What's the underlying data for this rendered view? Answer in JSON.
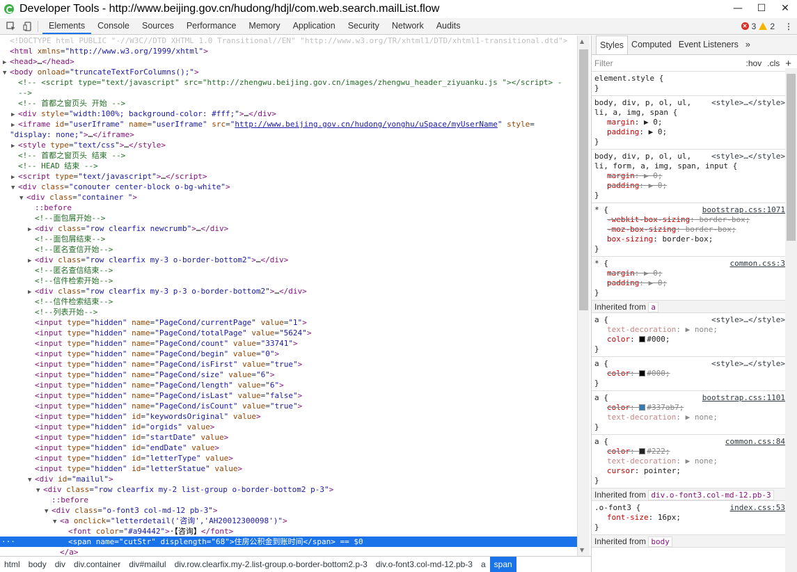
{
  "window": {
    "title": "Developer Tools - http://www.beijing.gov.cn/hudong/hdjl/com.web.search.mailList.flow",
    "minimize": "—",
    "maximize": "☐",
    "close": "✕"
  },
  "toolbar": {
    "tabs": [
      "Elements",
      "Console",
      "Sources",
      "Performance",
      "Memory",
      "Application",
      "Security",
      "Network",
      "Audits"
    ],
    "errors": "3",
    "warnings": "2"
  },
  "elements": {
    "lines": [
      {
        "i": 0,
        "t": "",
        "h": "<span class=\"dt\">&lt;!DOCTYPE html PUBLIC \"-//W3C//DTD XHTML 1.0 Transitional//EN\" \"http://www.w3.org/TR/xhtml1/DTD/xhtml1-transitional.dtd\"&gt;</span>"
      },
      {
        "i": 0,
        "t": "",
        "h": "<span class=\"tg\">&lt;html</span> <span class=\"an\">xmlns</span>=<span class=\"av\">\"http://www.w3.org/1999/xhtml\"</span><span class=\"tg\">&gt;</span>"
      },
      {
        "i": 0,
        "t": "▶",
        "h": "<span class=\"tg\">&lt;head&gt;</span><span class=\"tx\">…</span><span class=\"tg\">&lt;/head&gt;</span>"
      },
      {
        "i": 0,
        "t": "▼",
        "h": "<span class=\"tg\">&lt;body</span> <span class=\"an\">onload</span>=<span class=\"av\">\"truncateTextForColumns();\"</span><span class=\"tg\">&gt;</span>"
      },
      {
        "i": 1,
        "t": "",
        "h": "<span class=\"cm\">&lt;!-- &lt;script type=\"text/javascript\" src=\"http://zhengwu.beijing.gov.cn/images/zhengwu_header_ziyuanku.js \"&gt;&lt;/script&gt;  -</span>"
      },
      {
        "i": 1,
        "t": "",
        "h": "<span class=\"cm\">--&gt;</span>"
      },
      {
        "i": 1,
        "t": "",
        "h": "<span class=\"cm\">&lt;!-- 首都之窗页头 开始 --&gt;</span>"
      },
      {
        "i": 1,
        "t": "▶",
        "h": "<span class=\"tg\">&lt;div</span> <span class=\"an\">style</span>=<span class=\"av\">\"width:100%; background-color: #fff;\"</span><span class=\"tg\">&gt;</span><span class=\"tx\">…</span><span class=\"tg\">&lt;/div&gt;</span>"
      },
      {
        "i": 1,
        "t": "▶",
        "h": "<span class=\"tg\">&lt;iframe</span> <span class=\"an\">id</span>=<span class=\"av\">\"userIframe\"</span> <span class=\"an\">name</span>=<span class=\"av\">\"userIframe\"</span> <span class=\"an\">src</span>=<span class=\"av\">\"</span><span class=\"lk\">http://www.beijing.gov.cn/hudong/yonghu/uSpace/myUserName</span><span class=\"av\">\"</span> <span class=\"an\">style</span>=</span>"
      },
      {
        "i": 0,
        "t": "",
        "h": "<span class=\"av\">\"display: none;\"</span><span class=\"tg\">&gt;</span><span class=\"tx\">…</span><span class=\"tg\">&lt;/iframe&gt;</span>"
      },
      {
        "i": 1,
        "t": "▶",
        "h": "<span class=\"tg\">&lt;style</span> <span class=\"an\">type</span>=<span class=\"av\">\"text/css\"</span><span class=\"tg\">&gt;</span><span class=\"tx\">…</span><span class=\"tg\">&lt;/style&gt;</span>"
      },
      {
        "i": 1,
        "t": "",
        "h": "<span class=\"cm\">&lt;!-- 首都之窗页头 结束 --&gt;</span>"
      },
      {
        "i": 1,
        "t": "",
        "h": "<span class=\"cm\">&lt;!-- HEAD 结束 --&gt;</span>"
      },
      {
        "i": 1,
        "t": "▶",
        "h": "<span class=\"tg\">&lt;script</span> <span class=\"an\">type</span>=<span class=\"av\">\"text/javascript\"</span><span class=\"tg\">&gt;</span><span class=\"tx\">…</span><span class=\"tg\">&lt;/script&gt;</span>"
      },
      {
        "i": 1,
        "t": "▼",
        "h": "<span class=\"tg\">&lt;div</span> <span class=\"an\">class</span>=<span class=\"av\">\"conouter center-block o-bg-white\"</span><span class=\"tg\">&gt;</span>"
      },
      {
        "i": 2,
        "t": "▼",
        "h": "<span class=\"tg\">&lt;div</span> <span class=\"an\">class</span>=<span class=\"av\">\"container \"</span><span class=\"tg\">&gt;</span>"
      },
      {
        "i": 3,
        "t": "",
        "h": "<span class=\"ps\">::before</span>"
      },
      {
        "i": 3,
        "t": "",
        "h": "<span class=\"cm\">&lt;!--面包屑开始--&gt;</span>"
      },
      {
        "i": 3,
        "t": "▶",
        "h": "<span class=\"tg\">&lt;div</span> <span class=\"an\">class</span>=<span class=\"av\">\"row clearfix  newcrumb\"</span><span class=\"tg\">&gt;</span><span class=\"tx\">…</span><span class=\"tg\">&lt;/div&gt;</span>"
      },
      {
        "i": 3,
        "t": "",
        "h": "<span class=\"cm\">&lt;!--面包屑结束--&gt;</span>"
      },
      {
        "i": 3,
        "t": "",
        "h": "<span class=\"cm\">&lt;!--匿名查信开始--&gt;</span>"
      },
      {
        "i": 3,
        "t": "▶",
        "h": "<span class=\"tg\">&lt;div</span> <span class=\"an\">class</span>=<span class=\"av\">\"row clearfix my-3 o-border-bottom2\"</span><span class=\"tg\">&gt;</span><span class=\"tx\">…</span><span class=\"tg\">&lt;/div&gt;</span>"
      },
      {
        "i": 3,
        "t": "",
        "h": "<span class=\"cm\">&lt;!--匿名查信结束--&gt;</span>"
      },
      {
        "i": 3,
        "t": "",
        "h": "<span class=\"cm\">&lt;!--信件检索开始--&gt;</span>"
      },
      {
        "i": 3,
        "t": "▶",
        "h": "<span class=\"tg\">&lt;div</span> <span class=\"an\">class</span>=<span class=\"av\">\"row clearfix my-3 p-3 o-border-bottom2\"</span><span class=\"tg\">&gt;</span><span class=\"tx\">…</span><span class=\"tg\">&lt;/div&gt;</span>"
      },
      {
        "i": 3,
        "t": "",
        "h": "<span class=\"cm\">&lt;!--信件检索结束--&gt;</span>"
      },
      {
        "i": 3,
        "t": "",
        "h": "<span class=\"cm\">&lt;!--列表开始--&gt;</span>"
      },
      {
        "i": 3,
        "t": "",
        "h": "<span class=\"tg\">&lt;input</span> <span class=\"an\">type</span>=<span class=\"av\">\"hidden\"</span> <span class=\"an\">name</span>=<span class=\"av\">\"PageCond/currentPage\"</span> <span class=\"an\">value</span>=<span class=\"av\">\"1\"</span><span class=\"tg\">&gt;</span>"
      },
      {
        "i": 3,
        "t": "",
        "h": "<span class=\"tg\">&lt;input</span> <span class=\"an\">type</span>=<span class=\"av\">\"hidden\"</span> <span class=\"an\">name</span>=<span class=\"av\">\"PageCond/totalPage\"</span> <span class=\"an\">value</span>=<span class=\"av\">\"5624\"</span><span class=\"tg\">&gt;</span>"
      },
      {
        "i": 3,
        "t": "",
        "h": "<span class=\"tg\">&lt;input</span> <span class=\"an\">type</span>=<span class=\"av\">\"hidden\"</span> <span class=\"an\">name</span>=<span class=\"av\">\"PageCond/count\"</span> <span class=\"an\">value</span>=<span class=\"av\">\"33741\"</span><span class=\"tg\">&gt;</span>"
      },
      {
        "i": 3,
        "t": "",
        "h": "<span class=\"tg\">&lt;input</span> <span class=\"an\">type</span>=<span class=\"av\">\"hidden\"</span> <span class=\"an\">name</span>=<span class=\"av\">\"PageCond/begin\"</span> <span class=\"an\">value</span>=<span class=\"av\">\"0\"</span><span class=\"tg\">&gt;</span>"
      },
      {
        "i": 3,
        "t": "",
        "h": "<span class=\"tg\">&lt;input</span> <span class=\"an\">type</span>=<span class=\"av\">\"hidden\"</span> <span class=\"an\">name</span>=<span class=\"av\">\"PageCond/isFirst\"</span> <span class=\"an\">value</span>=<span class=\"av\">\"true\"</span><span class=\"tg\">&gt;</span>"
      },
      {
        "i": 3,
        "t": "",
        "h": "<span class=\"tg\">&lt;input</span> <span class=\"an\">type</span>=<span class=\"av\">\"hidden\"</span> <span class=\"an\">name</span>=<span class=\"av\">\"PageCond/size\"</span> <span class=\"an\">value</span>=<span class=\"av\">\"6\"</span><span class=\"tg\">&gt;</span>"
      },
      {
        "i": 3,
        "t": "",
        "h": "<span class=\"tg\">&lt;input</span> <span class=\"an\">type</span>=<span class=\"av\">\"hidden\"</span> <span class=\"an\">name</span>=<span class=\"av\">\"PageCond/length\"</span> <span class=\"an\">value</span>=<span class=\"av\">\"6\"</span><span class=\"tg\">&gt;</span>"
      },
      {
        "i": 3,
        "t": "",
        "h": "<span class=\"tg\">&lt;input</span> <span class=\"an\">type</span>=<span class=\"av\">\"hidden\"</span> <span class=\"an\">name</span>=<span class=\"av\">\"PageCond/isLast\"</span> <span class=\"an\">value</span>=<span class=\"av\">\"false\"</span><span class=\"tg\">&gt;</span>"
      },
      {
        "i": 3,
        "t": "",
        "h": "<span class=\"tg\">&lt;input</span> <span class=\"an\">type</span>=<span class=\"av\">\"hidden\"</span> <span class=\"an\">name</span>=<span class=\"av\">\"PageCond/isCount\"</span> <span class=\"an\">value</span>=<span class=\"av\">\"true\"</span><span class=\"tg\">&gt;</span>"
      },
      {
        "i": 3,
        "t": "",
        "h": "<span class=\"tg\">&lt;input</span> <span class=\"an\">type</span>=<span class=\"av\">\"hidden\"</span> <span class=\"an\">id</span>=<span class=\"av\">\"keywordsOriginal\"</span> <span class=\"an\">value</span><span class=\"tg\">&gt;</span>"
      },
      {
        "i": 3,
        "t": "",
        "h": "<span class=\"tg\">&lt;input</span> <span class=\"an\">type</span>=<span class=\"av\">\"hidden\"</span> <span class=\"an\">id</span>=<span class=\"av\">\"orgids\"</span> <span class=\"an\">value</span><span class=\"tg\">&gt;</span>"
      },
      {
        "i": 3,
        "t": "",
        "h": "<span class=\"tg\">&lt;input</span> <span class=\"an\">type</span>=<span class=\"av\">\"hidden\"</span> <span class=\"an\">id</span>=<span class=\"av\">\"startDate\"</span> <span class=\"an\">value</span><span class=\"tg\">&gt;</span>"
      },
      {
        "i": 3,
        "t": "",
        "h": "<span class=\"tg\">&lt;input</span> <span class=\"an\">type</span>=<span class=\"av\">\"hidden\"</span> <span class=\"an\">id</span>=<span class=\"av\">\"endDate\"</span> <span class=\"an\">value</span><span class=\"tg\">&gt;</span>"
      },
      {
        "i": 3,
        "t": "",
        "h": "<span class=\"tg\">&lt;input</span> <span class=\"an\">type</span>=<span class=\"av\">\"hidden\"</span> <span class=\"an\">id</span>=<span class=\"av\">\"letterType\"</span> <span class=\"an\">value</span><span class=\"tg\">&gt;</span>"
      },
      {
        "i": 3,
        "t": "",
        "h": "<span class=\"tg\">&lt;input</span> <span class=\"an\">type</span>=<span class=\"av\">\"hidden\"</span> <span class=\"an\">id</span>=<span class=\"av\">\"letterStatue\"</span> <span class=\"an\">value</span><span class=\"tg\">&gt;</span>"
      },
      {
        "i": 3,
        "t": "▼",
        "h": "<span class=\"tg\">&lt;div</span> <span class=\"an\">id</span>=<span class=\"av\">\"mailul\"</span><span class=\"tg\">&gt;</span>"
      },
      {
        "i": 4,
        "t": "▼",
        "h": "<span class=\"tg\">&lt;div</span> <span class=\"an\">class</span>=<span class=\"av\">\"row clearfix  my-2 list-group o-border-bottom2 p-3\"</span><span class=\"tg\">&gt;</span>"
      },
      {
        "i": 5,
        "t": "",
        "h": "<span class=\"ps\">::before</span>"
      },
      {
        "i": 5,
        "t": "▼",
        "h": "<span class=\"tg\">&lt;div</span> <span class=\"an\">class</span>=<span class=\"av\">\"o-font3 col-md-12 pb-3\"</span><span class=\"tg\">&gt;</span>"
      },
      {
        "i": 6,
        "t": "▼",
        "h": "<span class=\"tg\">&lt;a</span> <span class=\"an\">onclick</span>=<span class=\"av\">\"letterdetail('咨询','AH20012300098')\"</span><span class=\"tg\">&gt;</span>"
      },
      {
        "i": 7,
        "t": "",
        "h": "<span class=\"tg\">&lt;font</span> <span class=\"an\">color</span>=<span class=\"av\">\"#a94442\"</span><span class=\"tg\">&gt;</span><span class=\"tx\">·【咨询】</span><span class=\"tg\">&lt;/font&gt;</span>"
      },
      {
        "i": 7,
        "t": "",
        "sel": true,
        "h": "<span class=\"tg\">&lt;span</span> <span class=\"an\">name</span>=<span class=\"av\">\"cutStr\"</span> <span class=\"an\">displength</span>=<span class=\"av\">\"68\"</span><span class=\"tg\">&gt;</span><span class=\"tx\">住房公积金到账时间</span><span class=\"tg\">&lt;/span&gt;</span><span class=\"tx\"> == $0</span>"
      },
      {
        "i": 6,
        "t": "",
        "h": "<span class=\"tg\">&lt;/a&gt;</span>"
      }
    ]
  },
  "breadcrumb": [
    "html",
    "body",
    "div",
    "div.container",
    "div#mailul",
    "div.row.clearfix.my-2.list-group.o-border-bottom2.p-3",
    "div.o-font3.col-md-12.pb-3",
    "a",
    "span"
  ],
  "sidebar": {
    "tabs": [
      "Styles",
      "Computed",
      "Event Listeners"
    ],
    "filter_placeholder": "Filter",
    "hov": ":hov",
    "cls": ".cls",
    "rules": [
      {
        "sel": "element.style {",
        "src": "",
        "link": false,
        "decls": []
      },
      {
        "sel": "body, div, p, ol, ul,\nli, a, img, span {",
        "src": "<style>…</style>",
        "link": false,
        "decls": [
          [
            "margin",
            "▶ 0",
            false,
            false
          ],
          [
            "padding",
            "▶ 0",
            false,
            false
          ]
        ]
      },
      {
        "sel": "body, div, p, ol, ul,\nli, form, a, img, span, input {",
        "src": "<style>…</style>",
        "link": false,
        "decls": [
          [
            "margin",
            "▶ 0",
            true,
            false
          ],
          [
            "padding",
            "▶ 0",
            true,
            false
          ]
        ]
      },
      {
        "sel": "* {",
        "src": "bootstrap.css:1071",
        "link": true,
        "decls": [
          [
            "-webkit-box-sizing",
            "border-box",
            true,
            false
          ],
          [
            "-moz-box-sizing",
            "border-box",
            true,
            false
          ],
          [
            "box-sizing",
            "border-box",
            false,
            false
          ]
        ]
      },
      {
        "sel": "* {",
        "src": "common.css:3",
        "link": true,
        "decls": [
          [
            "margin",
            "▶ 0",
            true,
            false
          ],
          [
            "padding",
            "▶ 0",
            true,
            false
          ]
        ]
      }
    ],
    "inherit1": "a",
    "rules2": [
      {
        "sel": "a {",
        "src": "<style>…</style>",
        "link": false,
        "decls": [
          [
            "text-decoration",
            "▶ none",
            false,
            true
          ],
          [
            "color",
            "#000",
            false,
            false,
            "#000000"
          ]
        ]
      },
      {
        "sel": "a {",
        "src": "<style>…</style>",
        "link": false,
        "decls": [
          [
            "color",
            "#000",
            true,
            false,
            "#000000"
          ]
        ]
      },
      {
        "sel": "a {",
        "src": "bootstrap.css:1101",
        "link": true,
        "decls": [
          [
            "color",
            "#337ab7",
            true,
            false,
            "#337ab7"
          ],
          [
            "text-decoration",
            "▶ none",
            false,
            true
          ]
        ]
      },
      {
        "sel": "a {",
        "src": "common.css:84",
        "link": true,
        "decls": [
          [
            "color",
            "#222",
            true,
            false,
            "#222222"
          ],
          [
            "text-decoration",
            "▶ none",
            false,
            true
          ],
          [
            "cursor",
            "pointer",
            false,
            false
          ]
        ]
      }
    ],
    "inherit2": "div.o-font3.col-md-12.pb-3",
    "rules3": [
      {
        "sel": ".o-font3 {",
        "src": "index.css:53",
        "link": true,
        "decls": [
          [
            "font-size",
            "16px",
            false,
            false
          ]
        ]
      }
    ],
    "inherit3": "body",
    "inherit_label": "Inherited from"
  }
}
